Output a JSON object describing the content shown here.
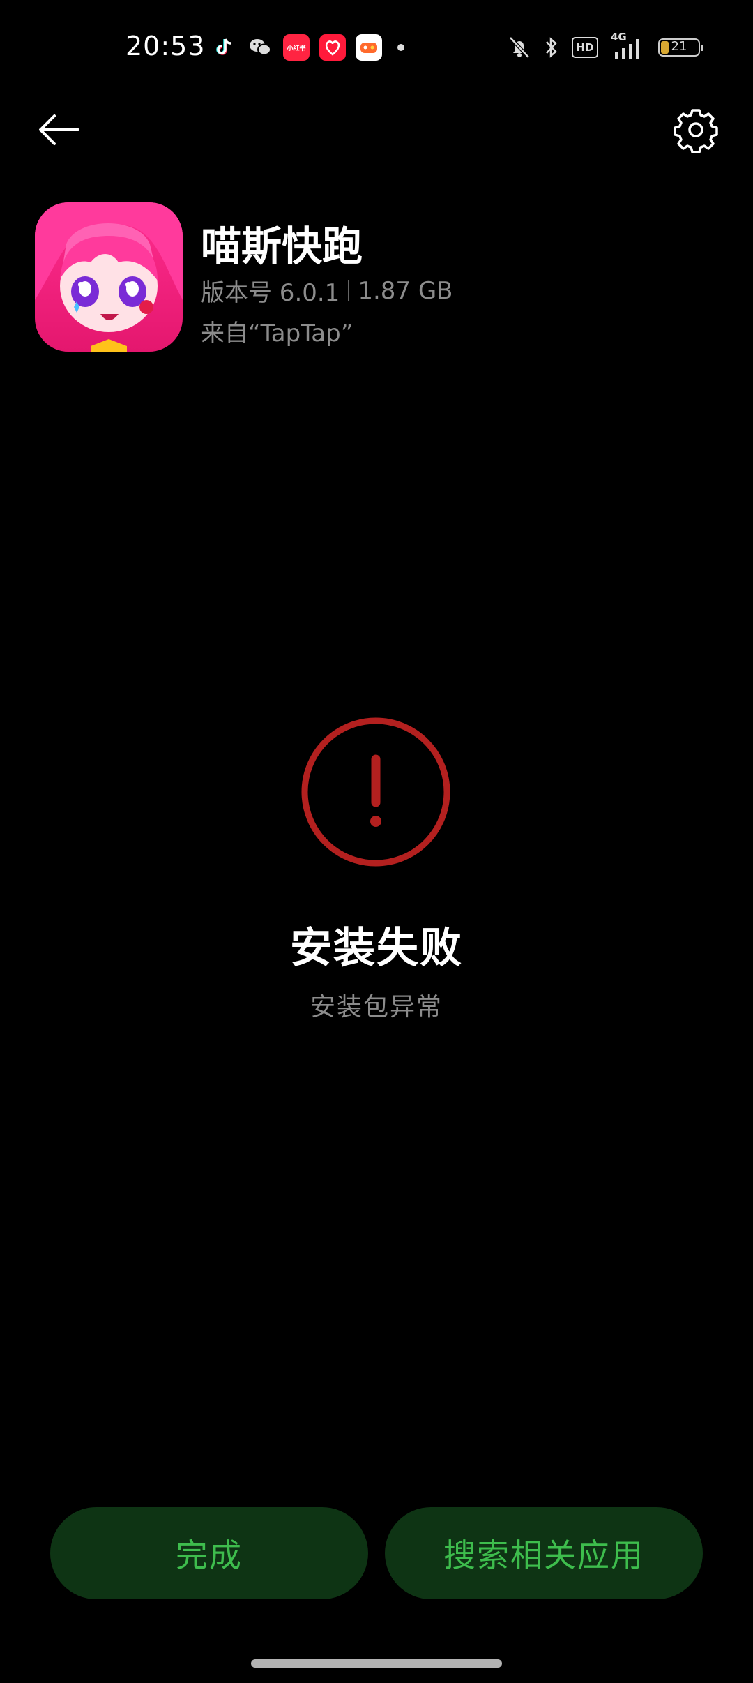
{
  "status_bar": {
    "time": "20:53",
    "notification_icons": [
      "tiktok-icon",
      "wechat-icon",
      "xiaohongshu-icon",
      "tmall-icon",
      "game-center-icon"
    ],
    "xhs_label": "小红书",
    "network": "4G",
    "hd_label": "HD",
    "battery_level": "21",
    "battery_percent": 21,
    "battery_color": "#d8a832"
  },
  "nav": {
    "back_icon": "arrow-left-icon",
    "settings_icon": "gear-icon"
  },
  "app": {
    "name": "喵斯快跑",
    "version_label": "版本号 6.0.1",
    "size": "1.87 GB",
    "source": "来自“TapTap”"
  },
  "status": {
    "icon": "exclamation-circle-icon",
    "title": "安装失败",
    "message": "安装包异常",
    "error_color": "#b3201f"
  },
  "buttons": {
    "done": "完成",
    "search_related": "搜索相关应用",
    "button_bg": "#0e3414",
    "button_text_color": "#3ebd4d"
  }
}
